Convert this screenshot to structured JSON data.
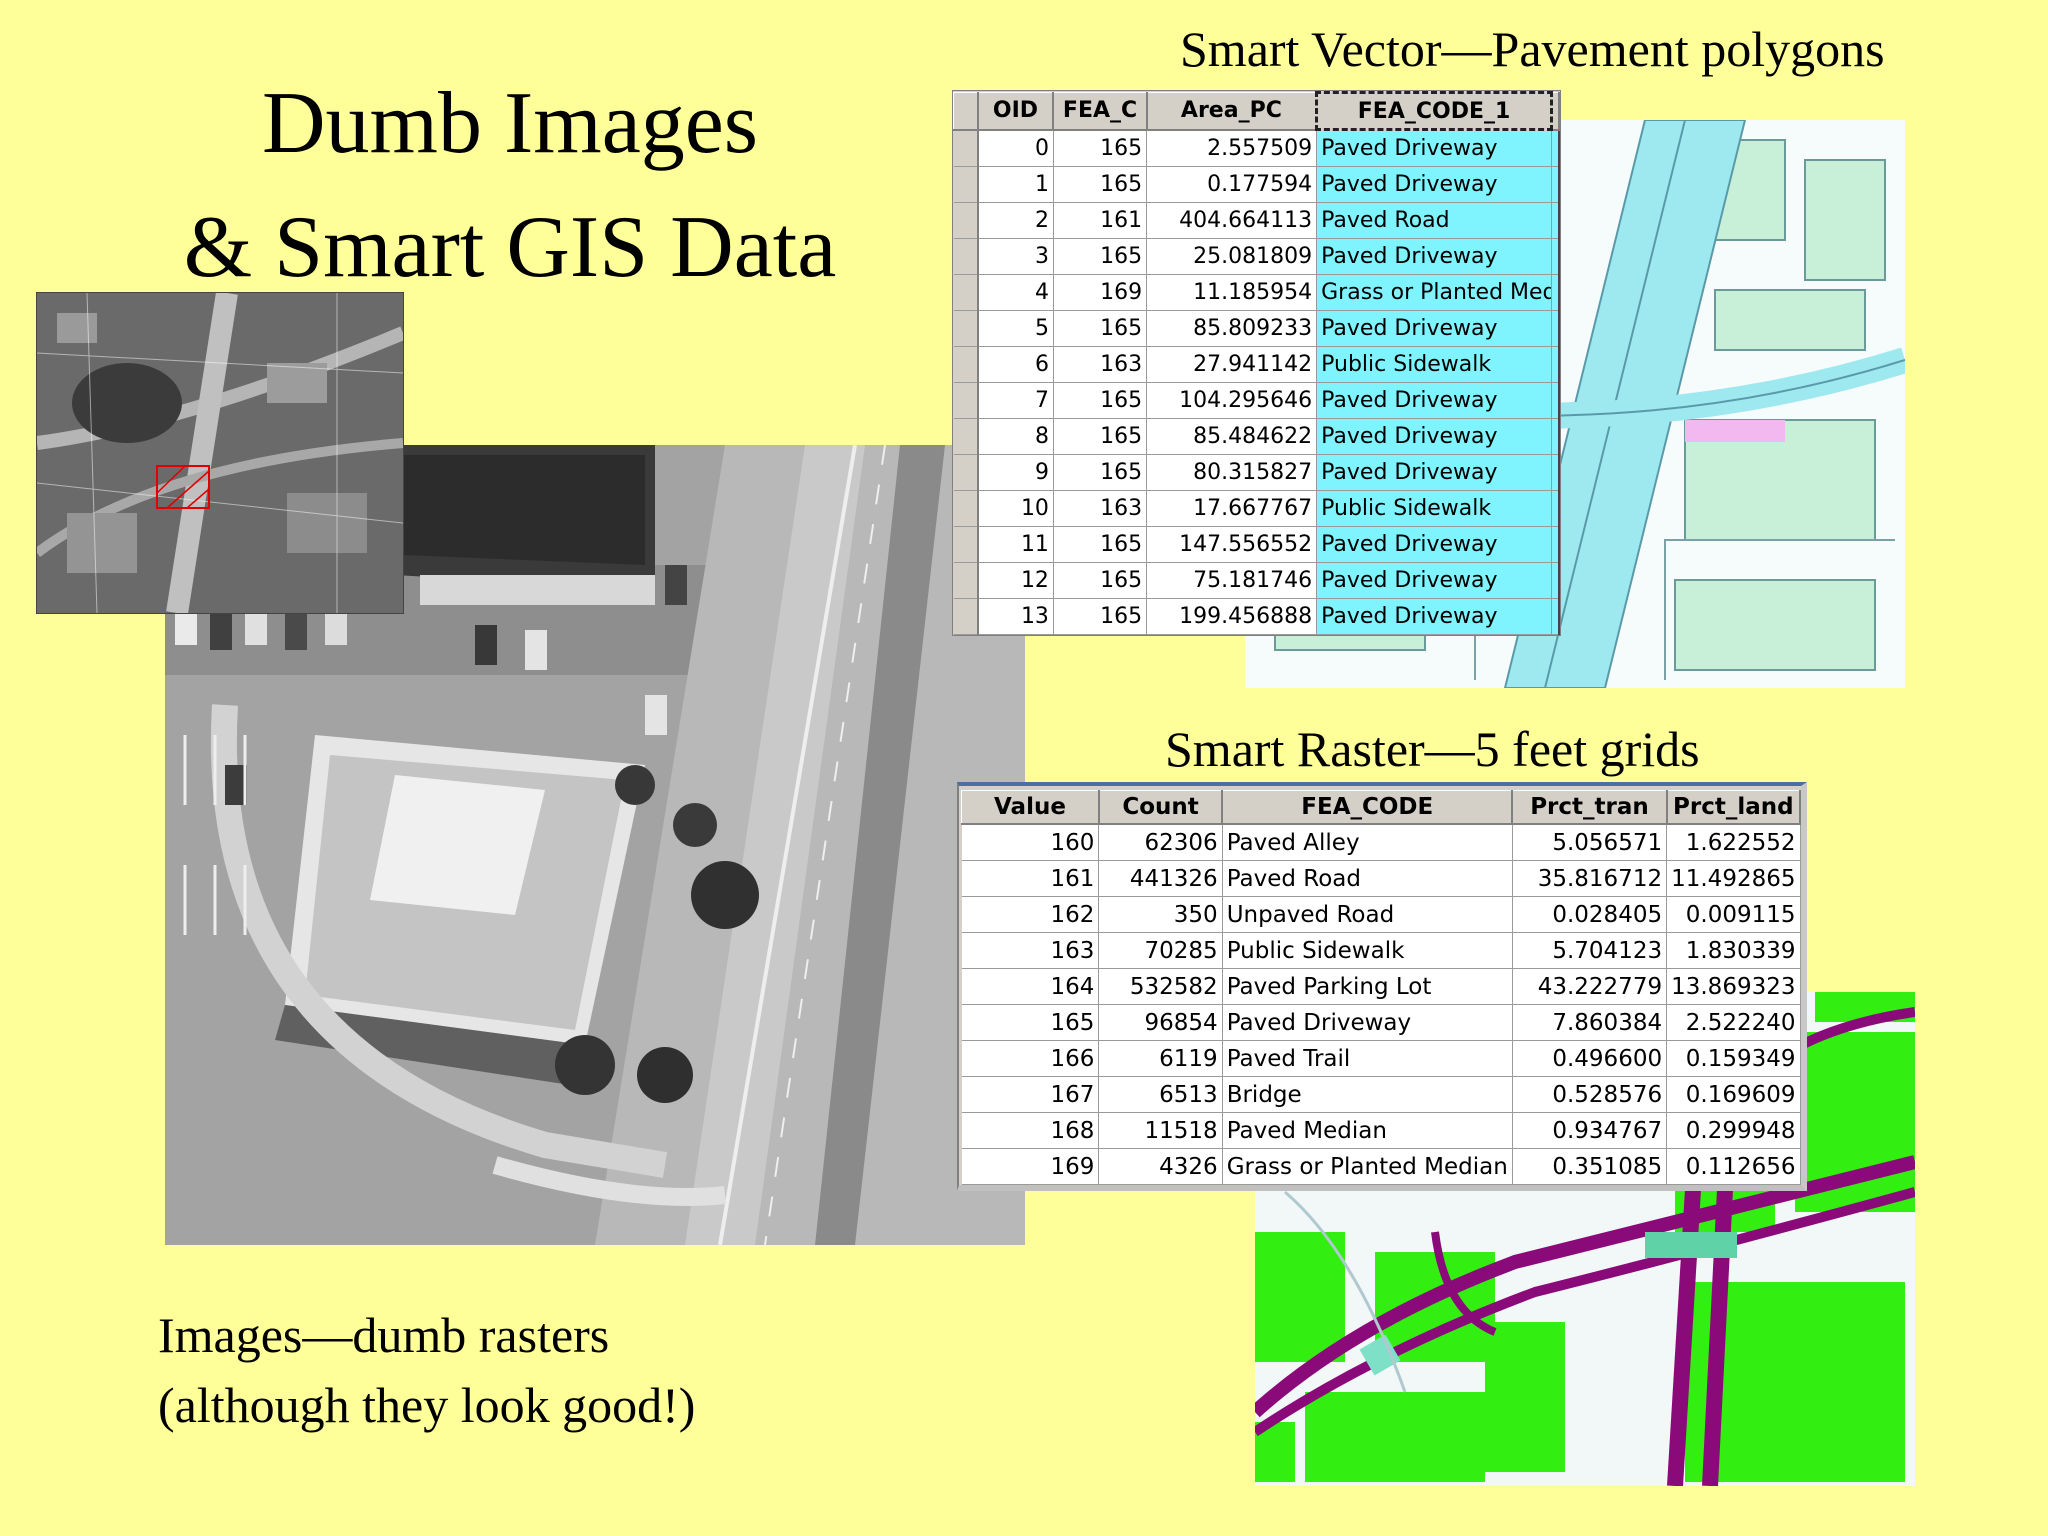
{
  "slide": {
    "title_line1": "Dumb Images",
    "title_line2": "& Smart GIS Data",
    "vector_label": "Smart Vector—Pavement polygons",
    "raster_label": "Smart Raster—5 feet grids",
    "caption_line1": "Images—dumb rasters",
    "caption_line2": "(although they look good!)"
  },
  "colors": {
    "background": "#ffff99",
    "table_highlight": "#7ff4ff",
    "raster_green": "#33ee11",
    "raster_road": "#8a0a7a",
    "vector_road": "#9ee8f0",
    "vector_parcel": "#c8f0d8",
    "bridge_pink": "#f2b8f0"
  },
  "vector_table": {
    "headers": [
      "OID",
      "FEA_C",
      "Area_PC",
      "FEA_CODE_1"
    ],
    "rows": [
      [
        "0",
        "165",
        "2.557509",
        "Paved Driveway"
      ],
      [
        "1",
        "165",
        "0.177594",
        "Paved Driveway"
      ],
      [
        "2",
        "161",
        "404.664113",
        "Paved Road"
      ],
      [
        "3",
        "165",
        "25.081809",
        "Paved Driveway"
      ],
      [
        "4",
        "169",
        "11.185954",
        "Grass or Planted Med"
      ],
      [
        "5",
        "165",
        "85.809233",
        "Paved Driveway"
      ],
      [
        "6",
        "163",
        "27.941142",
        "Public Sidewalk"
      ],
      [
        "7",
        "165",
        "104.295646",
        "Paved Driveway"
      ],
      [
        "8",
        "165",
        "85.484622",
        "Paved Driveway"
      ],
      [
        "9",
        "165",
        "80.315827",
        "Paved Driveway"
      ],
      [
        "10",
        "163",
        "17.667767",
        "Public Sidewalk"
      ],
      [
        "11",
        "165",
        "147.556552",
        "Paved Driveway"
      ],
      [
        "12",
        "165",
        "75.181746",
        "Paved Driveway"
      ],
      [
        "13",
        "165",
        "199.456888",
        "Paved Driveway"
      ]
    ]
  },
  "raster_table": {
    "headers": [
      "Value",
      "Count",
      "FEA_CODE",
      "Prct_tran",
      "Prct_land"
    ],
    "rows": [
      [
        "160",
        "62306",
        "Paved Alley",
        "5.056571",
        "1.622552"
      ],
      [
        "161",
        "441326",
        "Paved Road",
        "35.816712",
        "11.492865"
      ],
      [
        "162",
        "350",
        "Unpaved Road",
        "0.028405",
        "0.009115"
      ],
      [
        "163",
        "70285",
        "Public Sidewalk",
        "5.704123",
        "1.830339"
      ],
      [
        "164",
        "532582",
        "Paved Parking Lot",
        "43.222779",
        "13.869323"
      ],
      [
        "165",
        "96854",
        "Paved Driveway",
        "7.860384",
        "2.522240"
      ],
      [
        "166",
        "6119",
        "Paved Trail",
        "0.496600",
        "0.159349"
      ],
      [
        "167",
        "6513",
        "Bridge",
        "0.528576",
        "0.169609"
      ],
      [
        "168",
        "11518",
        "Paved Median",
        "0.934767",
        "0.299948"
      ],
      [
        "169",
        "4326",
        "Grass or Planted Median",
        "0.351085",
        "0.112656"
      ]
    ]
  }
}
